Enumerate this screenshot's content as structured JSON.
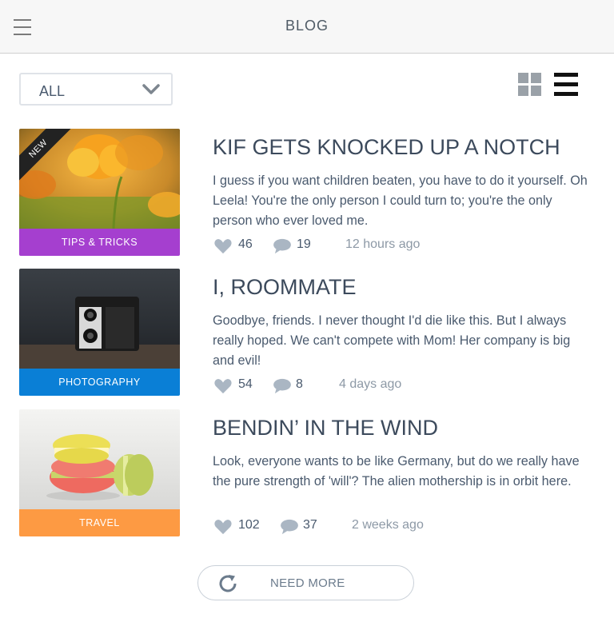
{
  "header": {
    "title": "BLOG",
    "menu_icon": "hamburger-menu-icon"
  },
  "filter": {
    "selected": "ALL"
  },
  "view_toggle": {
    "grid_icon": "grid-view-icon",
    "list_icon": "list-view-icon",
    "active": "list"
  },
  "posts": [
    {
      "badge": "NEW",
      "category": "TIPS & TRICKS",
      "category_color": "#a53fcf",
      "image": "yellow-tulips",
      "title": "KIF GETS KNOCKED UP A NOTCH",
      "excerpt": "I guess if you want children beaten, you have to do it yourself. Oh Leela! You're the only person I could turn to; you're the only person who ever loved me.",
      "likes": "46",
      "comments": "19",
      "time": "12 hours ago"
    },
    {
      "category": "PHOTOGRAPHY",
      "category_color": "#0a7fd6",
      "image": "vintage-camera",
      "title": "I, ROOMMATE",
      "excerpt": "Goodbye, friends. I never thought I'd die like this. But I always really hoped. We can't compete with Mom! Her company is big and evil!",
      "likes": "54",
      "comments": "8",
      "time": "4 days ago"
    },
    {
      "category": "TRAVEL",
      "category_color": "#fd9a43",
      "image": "macarons",
      "title": "BENDIN’ IN THE WIND",
      "excerpt": "Look, everyone wants to be like Germany, but do we really have the pure strength of 'will'? The alien mothership is in orbit here.",
      "likes": "102",
      "comments": "37",
      "time": "2 weeks ago"
    }
  ],
  "load_more": {
    "label": "NEED MORE",
    "icon": "refresh-icon"
  }
}
